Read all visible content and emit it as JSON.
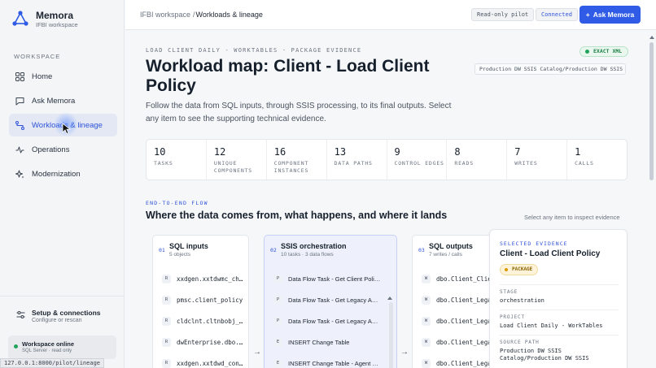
{
  "app": {
    "name": "Memora",
    "workspace": "IFBI workspace"
  },
  "sidebar": {
    "section_label": "WORKSPACE",
    "items": [
      {
        "label": "Home",
        "icon": "grid-icon"
      },
      {
        "label": "Ask Memora",
        "icon": "chat-icon"
      },
      {
        "label": "Workloads & lineage",
        "icon": "lineage-icon",
        "active": true
      },
      {
        "label": "Operations",
        "icon": "pulse-icon"
      },
      {
        "label": "Modernization",
        "icon": "sparkle-icon"
      }
    ],
    "setup": {
      "title": "Setup & connections",
      "subtitle": "Configure or rescan"
    },
    "status": {
      "title": "Workspace online",
      "subtitle": "SQL Server · read only"
    }
  },
  "statusbar_url": "127.0.0.1:8000/pilot/lineage",
  "topbar": {
    "breadcrumb_root": "IFBI workspace",
    "breadcrumb_sep": "/",
    "breadcrumb_current": "Workloads & lineage",
    "tag_readonly": "Read-only pilot",
    "tag_connected": "Connected",
    "ask_button": "Ask Memora"
  },
  "page": {
    "eyebrow": "LOAD CLIENT DAILY - WORKTABLES · PACKAGE EVIDENCE",
    "exact_badge": "EXACT XML",
    "source_path": "Production DW SSIS Catalog/Production DW SSIS ...",
    "title": "Workload map: Client - Load Client Policy",
    "lead": "Follow the data from SQL inputs, through SSIS processing, to its final outputs. Select any item to see the supporting technical evidence."
  },
  "stats": [
    {
      "value": "10",
      "label": "TASKS"
    },
    {
      "value": "12",
      "label": "UNIQUE COMPONENTS"
    },
    {
      "value": "16",
      "label": "COMPONENT INSTANCES"
    },
    {
      "value": "13",
      "label": "DATA PATHS"
    },
    {
      "value": "9",
      "label": "CONTROL EDGES"
    },
    {
      "value": "8",
      "label": "READS"
    },
    {
      "value": "7",
      "label": "WRITES"
    },
    {
      "value": "1",
      "label": "CALLS"
    }
  ],
  "flow": {
    "eyebrow": "END-TO-END FLOW",
    "title": "Where the data comes from, what happens, and where it lands",
    "hint": "Select any item to inspect evidence",
    "inputs": {
      "num": "01",
      "title": "SQL inputs",
      "subtitle": "5 objects",
      "rows": [
        {
          "badge": "R",
          "text": "xxdgen.xxtdwmc_ch…"
        },
        {
          "badge": "R",
          "text": "pmsc.client_policy"
        },
        {
          "badge": "R",
          "text": "cldclnt.cltnbobj_…"
        },
        {
          "badge": "R",
          "text": "dwEnterprise.dbo.…"
        },
        {
          "badge": "R",
          "text": "xxdgen.xxtdwd_con…"
        }
      ]
    },
    "orchestration": {
      "num": "02",
      "title": "SSIS orchestration",
      "subtitle": "10 tasks · 3 data flows",
      "rows": [
        {
          "badge": "P",
          "text": "Data Flow Task - Get Client Poli…"
        },
        {
          "badge": "P",
          "text": "Data Flow Task - Get Legacy A…"
        },
        {
          "badge": "P",
          "text": "Data Flow Task - Get Legacy A…"
        },
        {
          "badge": "E",
          "text": "INSERT Change Table"
        },
        {
          "badge": "E",
          "text": "INSERT Change Table - Agent …"
        }
      ]
    },
    "outputs": {
      "num": "03",
      "title": "SQL outputs",
      "subtitle": "7 writes / calls",
      "rows": [
        {
          "badge": "W",
          "text": "dbo.Client_Client…"
        },
        {
          "badge": "W",
          "text": "dbo.Client_Legacy…"
        },
        {
          "badge": "W",
          "text": "dbo.Client_Legacy…"
        },
        {
          "badge": "W",
          "text": "dbo.Client_Legacy…"
        },
        {
          "badge": "W",
          "text": "dbo.Client_Legacy…"
        }
      ]
    },
    "arrow": "→"
  },
  "evidence": {
    "eyebrow": "SELECTED EVIDENCE",
    "title": "Client - Load Client Policy",
    "pill": "PACKAGE",
    "stage_label": "STAGE",
    "stage_value": "orchestration",
    "project_label": "PROJECT",
    "project_value": "Load Client Daily - WorkTables",
    "source_label": "SOURCE PATH",
    "source_value": "Production DW SSIS Catalog/Production DW SSIS"
  },
  "colors": {
    "accent": "#2f5be6",
    "active_bg": "#e3e8f4",
    "success": "#21a35b",
    "warning": "#d99a00"
  }
}
